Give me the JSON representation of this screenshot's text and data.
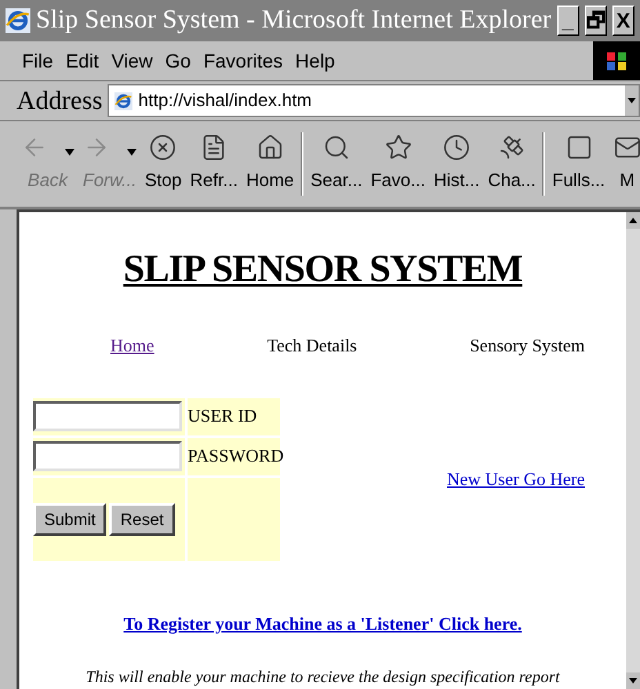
{
  "window": {
    "title": "Slip Sensor System - Microsoft Internet Explorer",
    "controls": [
      "_",
      "🗗",
      "X"
    ]
  },
  "menu": [
    {
      "label": "File"
    },
    {
      "label": "Edit"
    },
    {
      "label": "View"
    },
    {
      "label": "Go"
    },
    {
      "label": "Favorites"
    },
    {
      "label": "Help"
    }
  ],
  "address": {
    "label": "Address",
    "value": "http://vishal/index.htm"
  },
  "toolbar": [
    {
      "label": "Back",
      "disabled": true,
      "dropdown": true
    },
    {
      "label": "Forw...",
      "disabled": true,
      "dropdown": true
    },
    {
      "label": "Stop",
      "disabled": false,
      "dropdown": false
    },
    {
      "label": "Refr...",
      "disabled": false,
      "dropdown": false
    },
    {
      "label": "Home",
      "disabled": false,
      "dropdown": false,
      "separator_after": true
    },
    {
      "label": "Sear...",
      "disabled": false,
      "dropdown": false
    },
    {
      "label": "Favo...",
      "disabled": false,
      "dropdown": false
    },
    {
      "label": "Hist...",
      "disabled": false,
      "dropdown": false
    },
    {
      "label": "Cha...",
      "disabled": false,
      "dropdown": false,
      "separator_after": true
    },
    {
      "label": "Fulls...",
      "disabled": false,
      "dropdown": false
    },
    {
      "label": "M",
      "disabled": false,
      "dropdown": false
    }
  ],
  "page": {
    "heading": "SLIP SENSOR SYSTEM",
    "nav": [
      {
        "label": "Home",
        "visited": true,
        "link": true
      },
      {
        "label": "Tech Details",
        "visited": false,
        "link": false
      },
      {
        "label": "Sensory System",
        "visited": false,
        "link": false
      }
    ],
    "form": {
      "fields": [
        {
          "label": "USER ID"
        },
        {
          "label": "PASSWORD"
        }
      ],
      "buttons": [
        "Submit",
        "Reset"
      ]
    },
    "new_user_link": "New User Go Here",
    "register_link": "To Register your Machine as a 'Listener' Click here.",
    "note": "This will enable your machine to recieve the design specification report"
  }
}
